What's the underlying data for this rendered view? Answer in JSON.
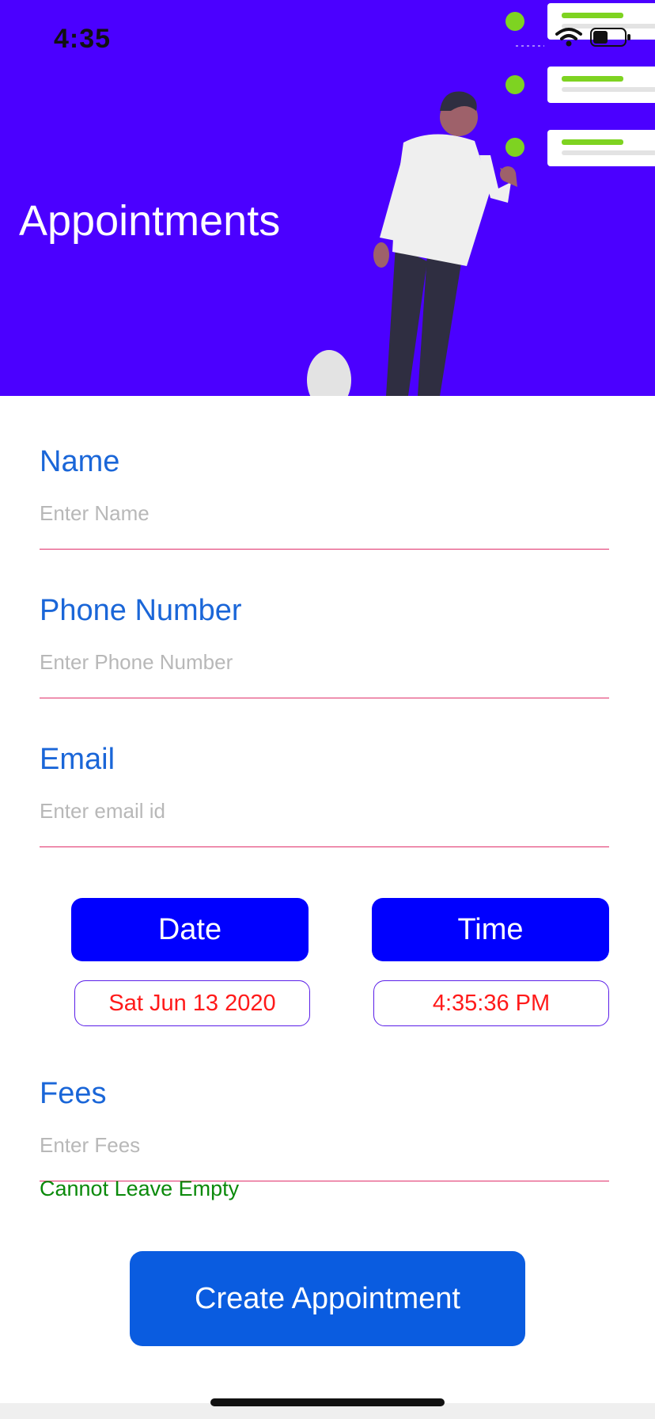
{
  "status_bar": {
    "time": "4:35"
  },
  "header": {
    "title": "Appointments"
  },
  "form": {
    "name": {
      "label": "Name",
      "placeholder": "Enter Name",
      "value": ""
    },
    "phone": {
      "label": "Phone Number",
      "placeholder": "Enter Phone Number",
      "value": ""
    },
    "email": {
      "label": "Email",
      "placeholder": "Enter email id",
      "value": ""
    },
    "date": {
      "button_label": "Date",
      "value": "Sat Jun 13 2020"
    },
    "time": {
      "button_label": "Time",
      "value": "4:35:36 PM"
    },
    "fees": {
      "label": "Fees",
      "placeholder": "Enter Fees",
      "value": "",
      "error": "Cannot Leave Empty"
    },
    "submit_label": "Create Appointment"
  },
  "colors": {
    "header_bg": "#4b00ff",
    "label": "#1a66d8",
    "underline": "#e0306a",
    "picker_button": "#0000ff",
    "picker_value": "#ff1a1a",
    "error": "#0b8a0b",
    "submit": "#0a5ce0",
    "accent_dots": "#7ed321"
  }
}
